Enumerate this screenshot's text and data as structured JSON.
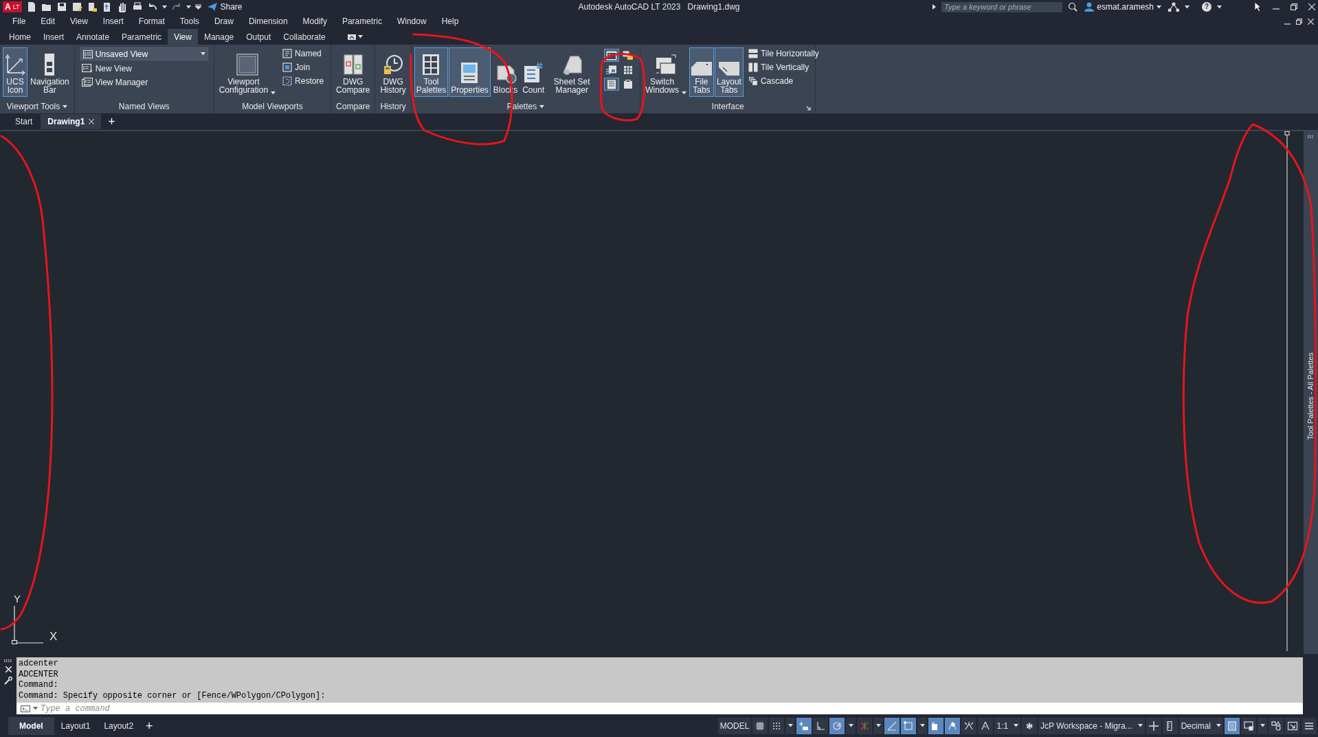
{
  "title_bar": {
    "logo": "A",
    "edition": "LT",
    "share": "Share",
    "title": "Autodesk AutoCAD LT 2023",
    "document": "Drawing1.dwg",
    "search": {
      "placeholder": "Type a keyword or phrase"
    },
    "user": "esmat.aramesh",
    "help": "?"
  },
  "menu_bar": [
    "File",
    "Edit",
    "View",
    "Insert",
    "Format",
    "Tools",
    "Draw",
    "Dimension",
    "Modify",
    "Parametric",
    "Window",
    "Help"
  ],
  "ribbon_tabs": [
    {
      "label": "Home",
      "selected": false
    },
    {
      "label": "Insert",
      "selected": false
    },
    {
      "label": "Annotate",
      "selected": false
    },
    {
      "label": "Parametric",
      "selected": false
    },
    {
      "label": "View",
      "selected": true
    },
    {
      "label": "Manage",
      "selected": false
    },
    {
      "label": "Output",
      "selected": false
    },
    {
      "label": "Collaborate",
      "selected": false
    }
  ],
  "ribbon_panels": [
    {
      "title": "Viewport Tools",
      "menu": true,
      "tools": [
        {
          "kind": "large",
          "label": "UCS Icon",
          "selected": true
        },
        {
          "kind": "large",
          "label": "Navigation Bar",
          "selected": false
        }
      ]
    },
    {
      "title": "Named Views",
      "tools": [
        {
          "kind": "combo",
          "label": "Unsaved View"
        },
        {
          "kind": "small",
          "label": "New View"
        },
        {
          "kind": "small",
          "label": "View Manager"
        }
      ]
    },
    {
      "title": "Model Viewports",
      "tools": [
        {
          "kind": "large",
          "label": "Viewport Configuration",
          "selected": false,
          "menu": true
        },
        {
          "kind": "small",
          "label": "Named"
        },
        {
          "kind": "small",
          "label": "Join"
        },
        {
          "kind": "small",
          "label": "Restore"
        }
      ]
    },
    {
      "title": "Compare",
      "tools": [
        {
          "kind": "large",
          "label": "DWG Compare",
          "selected": false
        }
      ]
    },
    {
      "title": "History",
      "tools": [
        {
          "kind": "large",
          "label": "DWG History",
          "selected": false
        }
      ]
    },
    {
      "title": "Palettes",
      "menu": true,
      "tools": [
        {
          "kind": "large",
          "label": "Tool Palettes",
          "selected": true
        },
        {
          "kind": "large",
          "label": "Properties",
          "selected": true
        },
        {
          "kind": "large",
          "label": "Blocks",
          "selected": false
        },
        {
          "kind": "large",
          "label": "Count",
          "selected": false
        },
        {
          "kind": "large",
          "label": "Sheet Set Manager",
          "selected": false
        },
        {
          "kind": "icon",
          "selected": true
        },
        {
          "kind": "icon",
          "selected": false
        },
        {
          "kind": "icon",
          "selected": false
        },
        {
          "kind": "icon",
          "selected": false
        },
        {
          "kind": "icon",
          "selected": true
        },
        {
          "kind": "icon",
          "selected": false
        }
      ]
    },
    {
      "title": "Interface",
      "launcher": true,
      "tools": [
        {
          "kind": "large",
          "label": "Switch Windows",
          "selected": false,
          "menu": true
        },
        {
          "kind": "large",
          "label": "File Tabs",
          "selected": true
        },
        {
          "kind": "large",
          "label": "Layout Tabs",
          "selected": true
        },
        {
          "kind": "small",
          "label": "Tile Horizontally"
        },
        {
          "kind": "small",
          "label": "Tile Vertically"
        },
        {
          "kind": "small",
          "label": "Cascade"
        }
      ]
    }
  ],
  "file_tabs": {
    "tabs": [
      {
        "label": "Start",
        "selected": false
      },
      {
        "label": "Drawing1",
        "selected": true
      }
    ],
    "add": "+"
  },
  "drawing": {
    "ucs_y": "Y",
    "ucs_x": "X"
  },
  "tool_palette_strip": {
    "title": "Tool Palettes - All Palettes"
  },
  "command_line": {
    "history": [
      "adcenter",
      "ADCENTER",
      "Command:",
      "Command: Specify opposite corner or [Fence/WPolygon/CPolygon]:"
    ],
    "placeholder": "Type a command"
  },
  "layout_tabs": {
    "tabs": [
      {
        "label": "Model",
        "selected": true
      },
      {
        "label": "Layout1",
        "selected": false
      },
      {
        "label": "Layout2",
        "selected": false
      }
    ],
    "add": "+"
  },
  "status_bar": [
    {
      "kind": "text",
      "label": "MODEL"
    },
    {
      "kind": "toggle",
      "on": false
    },
    {
      "kind": "toggle",
      "on": false
    },
    {
      "kind": "caret"
    },
    {
      "kind": "toggle",
      "on": true
    },
    {
      "kind": "toggle",
      "on": false
    },
    {
      "kind": "toggle",
      "on": true
    },
    {
      "kind": "caret"
    },
    {
      "kind": "toggle",
      "on": false
    },
    {
      "kind": "caret"
    },
    {
      "kind": "toggle",
      "on": true
    },
    {
      "kind": "toggle",
      "on": true
    },
    {
      "kind": "caret"
    },
    {
      "kind": "toggle",
      "on": true
    },
    {
      "kind": "toggle",
      "on": true
    },
    {
      "kind": "toggle",
      "on": false
    },
    {
      "kind": "toggle",
      "on": false
    },
    {
      "kind": "dropdown",
      "label": "1:1"
    },
    {
      "kind": "toggle",
      "on": false
    },
    {
      "kind": "dropdown",
      "label": "JcP Workspace - Migra..."
    },
    {
      "kind": "toggle",
      "on": false
    },
    {
      "kind": "toggle",
      "on": false
    },
    {
      "kind": "dropdown",
      "label": "Decimal"
    },
    {
      "kind": "toggle",
      "on": true
    },
    {
      "kind": "toggle",
      "on": false
    },
    {
      "kind": "caret"
    },
    {
      "kind": "toggle",
      "on": false
    },
    {
      "kind": "toggle",
      "on": false
    },
    {
      "kind": "toggle",
      "on": false
    }
  ]
}
